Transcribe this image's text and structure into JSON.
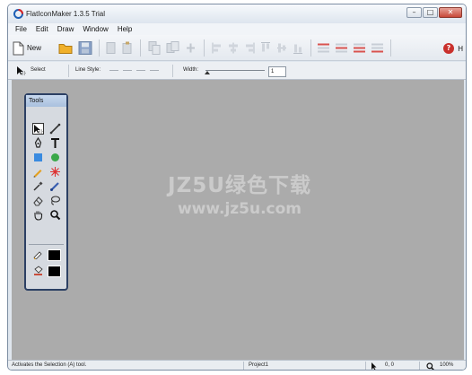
{
  "window": {
    "title": "FlatIconMaker 1.3.5 Trial",
    "controls": {
      "minimize": "–",
      "maximize": "□",
      "close": "✕"
    }
  },
  "menu": [
    "File",
    "Edit",
    "Draw",
    "Window",
    "Help"
  ],
  "toolbar": {
    "new_label": "New",
    "help_glyph": "?",
    "help_suffix": "H"
  },
  "options": {
    "select_label": "Select",
    "line_style_label": "Line Style:",
    "width_label": "Width:",
    "width_value": "1"
  },
  "tools_panel": {
    "title": "Tools",
    "tools": [
      "selection-arrow",
      "line",
      "pen",
      "text",
      "rectangle",
      "ellipse",
      "pencil",
      "star-burst",
      "eyedropper",
      "brush",
      "eraser",
      "lasso",
      "hand",
      "zoom"
    ],
    "stroke_color": "#000000",
    "fill_color": "#000000"
  },
  "watermark": {
    "line1": "JZ5U绿色下载",
    "line2": "www.jz5u.com"
  },
  "status": {
    "message": "Activates the Selection (A) tool.",
    "project": "Project1",
    "coords": "0, 0",
    "zoom": "100%"
  },
  "colors": {
    "workspace": "#ababab",
    "panel_border": "#2c4064",
    "help": "#c9302c"
  }
}
